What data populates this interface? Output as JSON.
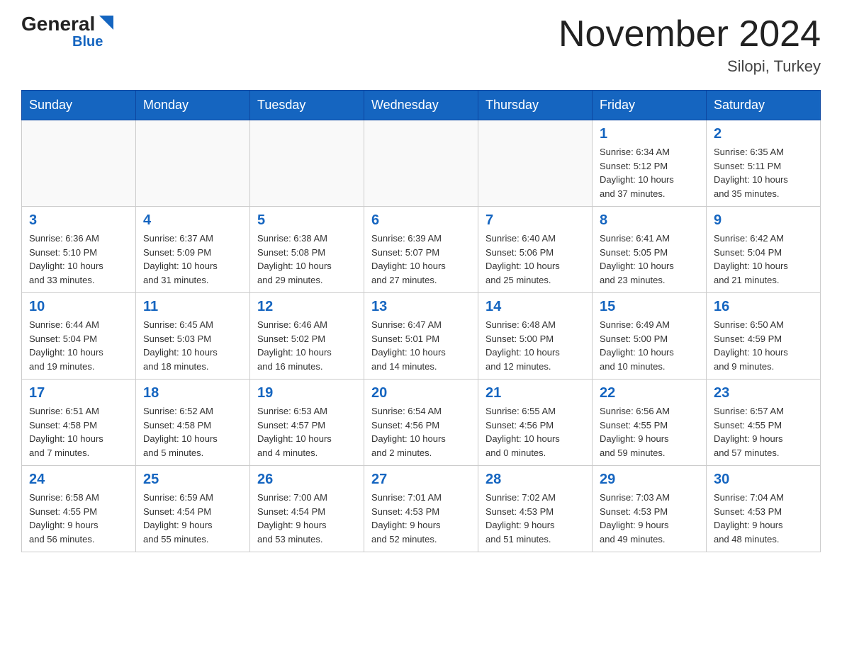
{
  "header": {
    "logo_general": "General",
    "logo_blue": "Blue",
    "month_title": "November 2024",
    "location": "Silopi, Turkey"
  },
  "weekdays": [
    "Sunday",
    "Monday",
    "Tuesday",
    "Wednesday",
    "Thursday",
    "Friday",
    "Saturday"
  ],
  "weeks": [
    [
      {
        "day": "",
        "info": ""
      },
      {
        "day": "",
        "info": ""
      },
      {
        "day": "",
        "info": ""
      },
      {
        "day": "",
        "info": ""
      },
      {
        "day": "",
        "info": ""
      },
      {
        "day": "1",
        "info": "Sunrise: 6:34 AM\nSunset: 5:12 PM\nDaylight: 10 hours\nand 37 minutes."
      },
      {
        "day": "2",
        "info": "Sunrise: 6:35 AM\nSunset: 5:11 PM\nDaylight: 10 hours\nand 35 minutes."
      }
    ],
    [
      {
        "day": "3",
        "info": "Sunrise: 6:36 AM\nSunset: 5:10 PM\nDaylight: 10 hours\nand 33 minutes."
      },
      {
        "day": "4",
        "info": "Sunrise: 6:37 AM\nSunset: 5:09 PM\nDaylight: 10 hours\nand 31 minutes."
      },
      {
        "day": "5",
        "info": "Sunrise: 6:38 AM\nSunset: 5:08 PM\nDaylight: 10 hours\nand 29 minutes."
      },
      {
        "day": "6",
        "info": "Sunrise: 6:39 AM\nSunset: 5:07 PM\nDaylight: 10 hours\nand 27 minutes."
      },
      {
        "day": "7",
        "info": "Sunrise: 6:40 AM\nSunset: 5:06 PM\nDaylight: 10 hours\nand 25 minutes."
      },
      {
        "day": "8",
        "info": "Sunrise: 6:41 AM\nSunset: 5:05 PM\nDaylight: 10 hours\nand 23 minutes."
      },
      {
        "day": "9",
        "info": "Sunrise: 6:42 AM\nSunset: 5:04 PM\nDaylight: 10 hours\nand 21 minutes."
      }
    ],
    [
      {
        "day": "10",
        "info": "Sunrise: 6:44 AM\nSunset: 5:04 PM\nDaylight: 10 hours\nand 19 minutes."
      },
      {
        "day": "11",
        "info": "Sunrise: 6:45 AM\nSunset: 5:03 PM\nDaylight: 10 hours\nand 18 minutes."
      },
      {
        "day": "12",
        "info": "Sunrise: 6:46 AM\nSunset: 5:02 PM\nDaylight: 10 hours\nand 16 minutes."
      },
      {
        "day": "13",
        "info": "Sunrise: 6:47 AM\nSunset: 5:01 PM\nDaylight: 10 hours\nand 14 minutes."
      },
      {
        "day": "14",
        "info": "Sunrise: 6:48 AM\nSunset: 5:00 PM\nDaylight: 10 hours\nand 12 minutes."
      },
      {
        "day": "15",
        "info": "Sunrise: 6:49 AM\nSunset: 5:00 PM\nDaylight: 10 hours\nand 10 minutes."
      },
      {
        "day": "16",
        "info": "Sunrise: 6:50 AM\nSunset: 4:59 PM\nDaylight: 10 hours\nand 9 minutes."
      }
    ],
    [
      {
        "day": "17",
        "info": "Sunrise: 6:51 AM\nSunset: 4:58 PM\nDaylight: 10 hours\nand 7 minutes."
      },
      {
        "day": "18",
        "info": "Sunrise: 6:52 AM\nSunset: 4:58 PM\nDaylight: 10 hours\nand 5 minutes."
      },
      {
        "day": "19",
        "info": "Sunrise: 6:53 AM\nSunset: 4:57 PM\nDaylight: 10 hours\nand 4 minutes."
      },
      {
        "day": "20",
        "info": "Sunrise: 6:54 AM\nSunset: 4:56 PM\nDaylight: 10 hours\nand 2 minutes."
      },
      {
        "day": "21",
        "info": "Sunrise: 6:55 AM\nSunset: 4:56 PM\nDaylight: 10 hours\nand 0 minutes."
      },
      {
        "day": "22",
        "info": "Sunrise: 6:56 AM\nSunset: 4:55 PM\nDaylight: 9 hours\nand 59 minutes."
      },
      {
        "day": "23",
        "info": "Sunrise: 6:57 AM\nSunset: 4:55 PM\nDaylight: 9 hours\nand 57 minutes."
      }
    ],
    [
      {
        "day": "24",
        "info": "Sunrise: 6:58 AM\nSunset: 4:55 PM\nDaylight: 9 hours\nand 56 minutes."
      },
      {
        "day": "25",
        "info": "Sunrise: 6:59 AM\nSunset: 4:54 PM\nDaylight: 9 hours\nand 55 minutes."
      },
      {
        "day": "26",
        "info": "Sunrise: 7:00 AM\nSunset: 4:54 PM\nDaylight: 9 hours\nand 53 minutes."
      },
      {
        "day": "27",
        "info": "Sunrise: 7:01 AM\nSunset: 4:53 PM\nDaylight: 9 hours\nand 52 minutes."
      },
      {
        "day": "28",
        "info": "Sunrise: 7:02 AM\nSunset: 4:53 PM\nDaylight: 9 hours\nand 51 minutes."
      },
      {
        "day": "29",
        "info": "Sunrise: 7:03 AM\nSunset: 4:53 PM\nDaylight: 9 hours\nand 49 minutes."
      },
      {
        "day": "30",
        "info": "Sunrise: 7:04 AM\nSunset: 4:53 PM\nDaylight: 9 hours\nand 48 minutes."
      }
    ]
  ]
}
